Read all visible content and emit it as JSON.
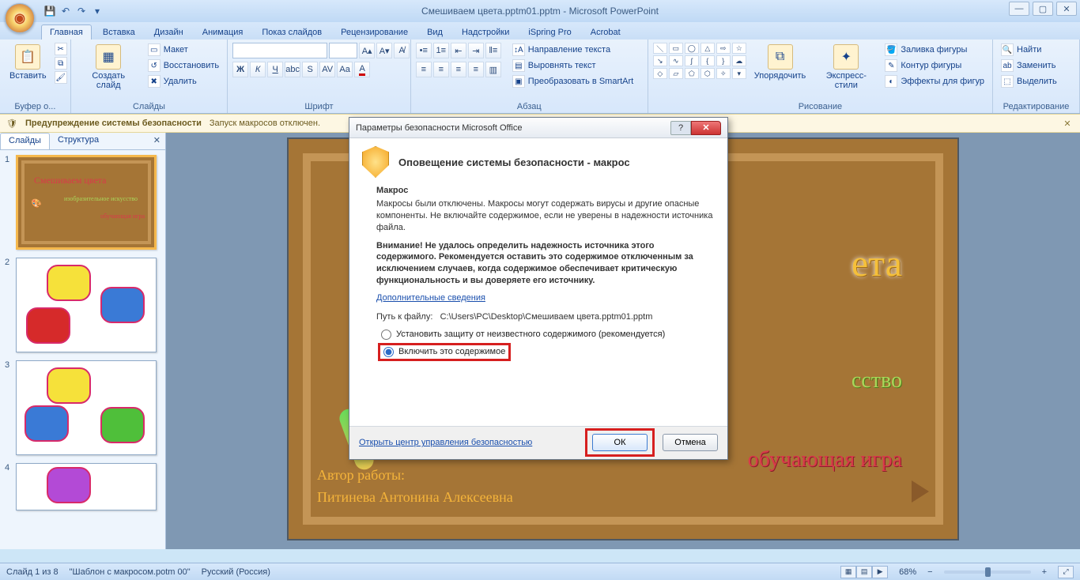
{
  "app": {
    "title": "Смешиваем цвета.pptm01.pptm - Microsoft PowerPoint"
  },
  "tabs": [
    "Главная",
    "Вставка",
    "Дизайн",
    "Анимация",
    "Показ слайдов",
    "Рецензирование",
    "Вид",
    "Надстройки",
    "iSpring Pro",
    "Acrobat"
  ],
  "ribbon": {
    "clipboard": {
      "label": "Буфер о...",
      "paste": "Вставить"
    },
    "slides": {
      "label": "Слайды",
      "new": "Создать слайд",
      "layout": "Макет",
      "reset": "Восстановить",
      "delete": "Удалить"
    },
    "font": {
      "label": "Шрифт",
      "size": ""
    },
    "paragraph": {
      "label": "Абзац",
      "textdir": "Направление текста",
      "align": "Выровнять текст",
      "smartart": "Преобразовать в SmartArt"
    },
    "drawing": {
      "label": "Рисование",
      "arrange": "Упорядочить",
      "styles": "Экспресс-стили",
      "fill": "Заливка фигуры",
      "outline": "Контур фигуры",
      "effects": "Эффекты для фигур"
    },
    "editing": {
      "label": "Редактирование",
      "find": "Найти",
      "replace": "Заменить",
      "select": "Выделить"
    }
  },
  "security_bar": {
    "title": "Предупреждение системы безопасности",
    "msg": "Запуск макросов отключен."
  },
  "side_tabs": {
    "slides": "Слайды",
    "outline": "Структура"
  },
  "thumbs": [
    1,
    2,
    3,
    4
  ],
  "slide": {
    "t1": "ета",
    "t2": "сство",
    "t3": "обучающая игра",
    "a1": "Автор работы:",
    "a2": "Питинева Антонина Алексеевна"
  },
  "dialog": {
    "title": "Параметры безопасности Microsoft Office",
    "heading": "Оповещение системы безопасности - макрос",
    "sub": "Макрос",
    "p1": "Макросы были отключены. Макросы могут содержать вирусы и другие опасные компоненты. Не включайте содержимое, если не уверены в надежности источника файла.",
    "p2": "Внимание! Не удалось определить надежность источника этого содержимого. Рекомендуется оставить это содержимое отключенным за исключением случаев, когда содержимое обеспечивает критическую функциональность и вы доверяете его источнику.",
    "more": "Дополнительные сведения",
    "path_label": "Путь к файлу:",
    "path": "C:\\Users\\PC\\Desktop\\Смешиваем цвета.pptm01.pptm",
    "opt1": "Установить защиту от неизвестного содержимого (рекомендуется)",
    "opt2": "Включить это содержимое",
    "trust_link": "Открыть центр управления безопасностью",
    "ok": "ОК",
    "cancel": "Отмена"
  },
  "status": {
    "slide": "Слайд 1 из 8",
    "template": "\"Шаблон с макросом.potm 00\"",
    "lang": "Русский (Россия)",
    "zoom": "68%"
  }
}
